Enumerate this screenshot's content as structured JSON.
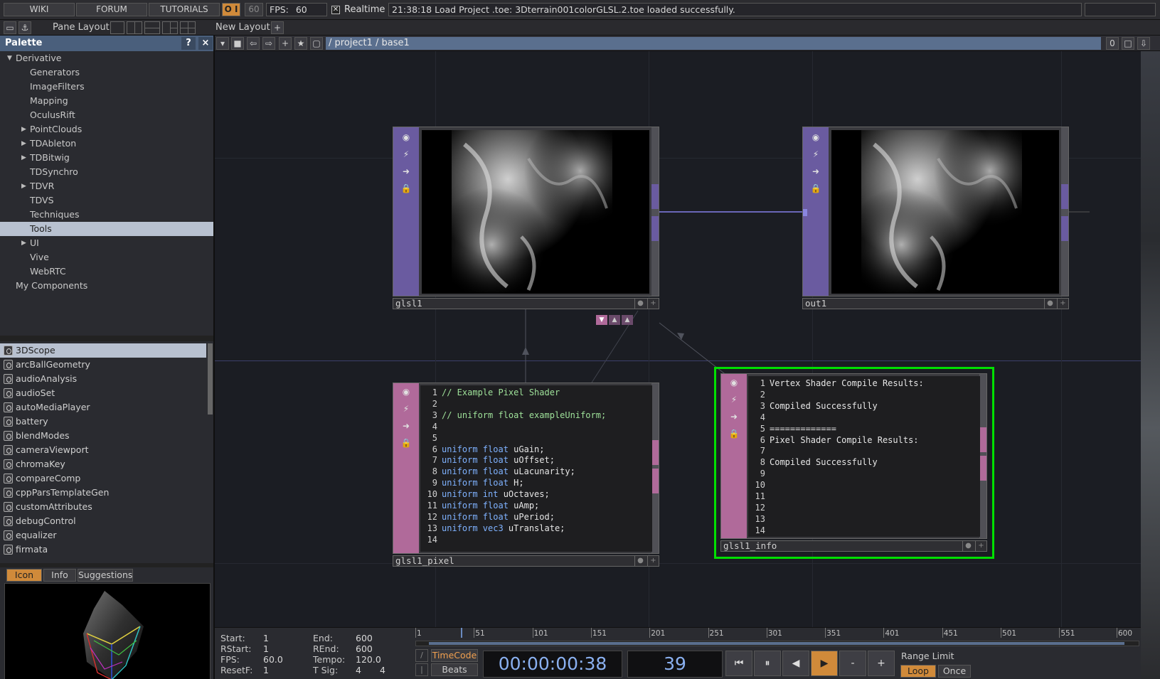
{
  "topbar": {
    "wiki": "WIKI",
    "forum": "FORUM",
    "tutorials": "TUTORIALS",
    "oi": "O I",
    "fps_target": "60",
    "fps_label": "FPS:",
    "fps_value": "60",
    "realtime_label": "Realtime",
    "realtime_checked": "✕",
    "status_message": "21:38:18 Load Project .toe: 3Dterrain001colorGLSL.2.toe loaded successfully."
  },
  "panebar": {
    "pane_layout": "Pane Layout",
    "new_layout": "New Layout",
    "plus": "+"
  },
  "palette": {
    "title": "Palette",
    "help": "?",
    "close": "×",
    "tree": [
      {
        "label": "Derivative",
        "expanded": true
      },
      {
        "label": "Generators"
      },
      {
        "label": "ImageFilters"
      },
      {
        "label": "Mapping"
      },
      {
        "label": "OculusRift"
      },
      {
        "label": "PointClouds",
        "collapsed": true
      },
      {
        "label": "TDAbleton",
        "collapsed": true
      },
      {
        "label": "TDBitwig",
        "collapsed": true
      },
      {
        "label": "TDSynchro"
      },
      {
        "label": "TDVR",
        "collapsed": true
      },
      {
        "label": "TDVS"
      },
      {
        "label": "Techniques"
      },
      {
        "label": "Tools",
        "selected": true
      },
      {
        "label": "UI",
        "collapsed": true
      },
      {
        "label": "Vive"
      },
      {
        "label": "WebRTC"
      },
      {
        "label": "My Components"
      }
    ],
    "components": [
      "3DScope",
      "arcBallGeometry",
      "audioAnalysis",
      "audioSet",
      "autoMediaPlayer",
      "battery",
      "blendModes",
      "cameraViewport",
      "chromaKey",
      "compareComp",
      "cppParsTemplateGen",
      "customAttributes",
      "debugControl",
      "equalizer",
      "firmata"
    ],
    "tabs": {
      "icon": "Icon",
      "info": "Info",
      "suggestions": "Suggestions"
    }
  },
  "netbar": {
    "path": "/ project1 / base1",
    "zero": "0"
  },
  "nodes": {
    "glsl1": {
      "name": "glsl1"
    },
    "out1": {
      "name": "out1"
    },
    "glsl1_pixel": {
      "name": "glsl1_pixel",
      "lines": [
        {
          "n": "1",
          "t": "// Example Pixel Shader",
          "c": "cm"
        },
        {
          "n": "2",
          "t": ""
        },
        {
          "n": "3",
          "t": "// uniform float exampleUniform;",
          "c": "cm"
        },
        {
          "n": "4",
          "t": ""
        },
        {
          "n": "5",
          "t": ""
        },
        {
          "n": "6",
          "k": "uniform float",
          "t": " uGain;"
        },
        {
          "n": "7",
          "k": "uniform float",
          "t": " uOffset;"
        },
        {
          "n": "8",
          "k": "uniform float",
          "t": " uLacunarity;"
        },
        {
          "n": "9",
          "k": "uniform float",
          "t": " H;"
        },
        {
          "n": "10",
          "k": "uniform int",
          "t": " uOctaves;"
        },
        {
          "n": "11",
          "k": "uniform float",
          "t": " uAmp;"
        },
        {
          "n": "12",
          "k": "uniform float",
          "t": " uPeriod;"
        },
        {
          "n": "13",
          "k": "uniform vec3",
          "t": " uTranslate;"
        },
        {
          "n": "14",
          "t": ""
        }
      ]
    },
    "glsl1_info": {
      "name": "glsl1_info",
      "lines": [
        {
          "n": "1",
          "t": "Vertex Shader Compile Results:"
        },
        {
          "n": "2",
          "t": ""
        },
        {
          "n": "3",
          "t": "Compiled Successfully"
        },
        {
          "n": "4",
          "t": ""
        },
        {
          "n": "5",
          "t": "============="
        },
        {
          "n": "6",
          "t": "Pixel Shader Compile Results:"
        },
        {
          "n": "7",
          "t": ""
        },
        {
          "n": "8",
          "t": "Compiled Successfully"
        },
        {
          "n": "9",
          "t": ""
        },
        {
          "n": "10",
          "t": ""
        },
        {
          "n": "11",
          "t": ""
        },
        {
          "n": "12",
          "t": ""
        },
        {
          "n": "13",
          "t": ""
        },
        {
          "n": "14",
          "t": ""
        }
      ]
    }
  },
  "timeline": {
    "start_label": "Start:",
    "start": "1",
    "end_label": "End:",
    "end": "600",
    "rstart_label": "RStart:",
    "rstart": "1",
    "rend_label": "REnd:",
    "rend": "600",
    "fps_label": "FPS:",
    "fps": "60.0",
    "tempo_label": "Tempo:",
    "tempo": "120.0",
    "resetf_label": "ResetF:",
    "resetf": "1",
    "tsig_label": "T Sig:",
    "tsig_a": "4",
    "tsig_b": "4",
    "ticks": [
      "1",
      "51",
      "101",
      "151",
      "201",
      "251",
      "301",
      "351",
      "401",
      "451",
      "501",
      "551",
      "600"
    ],
    "timecode_btn": "TimeCode",
    "beats_btn": "Beats",
    "timecode": "00:00:00:38",
    "frame": "39",
    "minus": "-",
    "plus": "+",
    "range_limit": "Range Limit",
    "loop": "Loop",
    "once": "Once"
  },
  "colors": {
    "accent_orange": "#d08a3a",
    "selection_green": "#00e000",
    "top_purple": "#6a5ba0",
    "dat_pink": "#b06a9a",
    "path_blue": "#5a6f8e"
  }
}
